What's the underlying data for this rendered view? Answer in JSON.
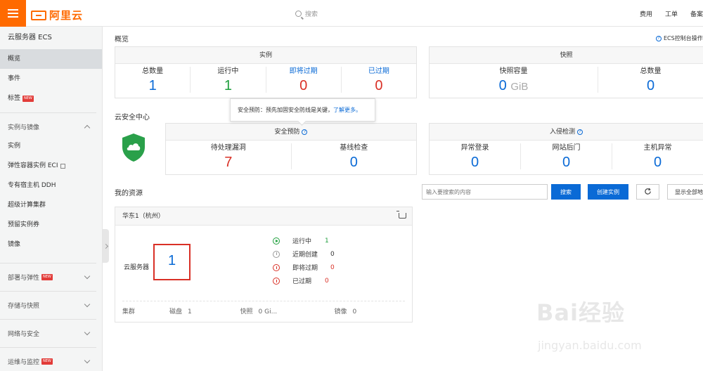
{
  "topbar": {
    "logo_text": "阿里云",
    "search_placeholder": "搜索",
    "links": [
      "费用",
      "工单",
      "备案"
    ]
  },
  "sidebar": {
    "title": "云服务器 ECS",
    "top_items": [
      {
        "label": "概览",
        "active": true,
        "badge": ""
      },
      {
        "label": "事件",
        "active": false,
        "badge": ""
      },
      {
        "label": "标签",
        "active": false,
        "badge": "NEW"
      }
    ],
    "group_instances": {
      "label": "实例与镜像",
      "expanded": true
    },
    "instance_items": [
      "实例",
      "弹性容器实例 ECI",
      "专有宿主机 DDH",
      "超级计算集群",
      "预留实例券",
      "镜像"
    ],
    "groups": [
      {
        "label": "部署与弹性",
        "badge": "NEW"
      },
      {
        "label": "存储与快照",
        "badge": ""
      },
      {
        "label": "网络与安全",
        "badge": ""
      },
      {
        "label": "运维与监控",
        "badge": "NEW"
      }
    ]
  },
  "overview": {
    "title": "概览",
    "console_link": "ECS控制台操作",
    "instances": {
      "header": "实例",
      "metrics": [
        {
          "label": "总数量",
          "value": "1",
          "color": "#0a6ad6"
        },
        {
          "label": "运行中",
          "value": "1",
          "color": "#1e9e3c"
        },
        {
          "label": "即将过期",
          "value": "0",
          "color": "#d93026"
        },
        {
          "label": "已过期",
          "value": "0",
          "color": "#d93026"
        }
      ]
    },
    "snapshots": {
      "header": "快照",
      "capacity_label": "快照容量",
      "capacity_value": "0",
      "capacity_unit": "GiB",
      "total_label": "总数量",
      "total_value": "0"
    }
  },
  "security": {
    "title": "云安全中心",
    "tooltip_text": "安全预防：预先加固安全防线是关键，",
    "tooltip_link": "了解更多。",
    "prevention": {
      "header": "安全预防",
      "metrics": [
        {
          "label": "待处理漏洞",
          "value": "7",
          "color": "#d93026"
        },
        {
          "label": "基线检查",
          "value": "0",
          "color": "#0a6ad6"
        }
      ]
    },
    "intrusion": {
      "header": "入侵检测",
      "metrics": [
        {
          "label": "异常登录",
          "value": "0"
        },
        {
          "label": "网站后门",
          "value": "0"
        },
        {
          "label": "主机异常",
          "value": "0"
        }
      ]
    }
  },
  "resources": {
    "title": "我的资源",
    "search_placeholder": "输入要搜索的内容",
    "search_button": "搜索",
    "create_button": "创建实例",
    "show_all_button": "显示全部地",
    "region": {
      "name": "华东1（杭州）",
      "server_label": "云服务器",
      "server_count": "1",
      "statuses": [
        {
          "label": "运行中",
          "value": "1",
          "color": "#1e9e3c",
          "icon": "play-icon"
        },
        {
          "label": "近期创建",
          "value": "0",
          "color": "#333333",
          "icon": "clock-icon"
        },
        {
          "label": "即将过期",
          "value": "0",
          "color": "#d93026",
          "icon": "alarm-icon"
        },
        {
          "label": "已过期",
          "value": "0",
          "color": "#d93026",
          "icon": "alarm-icon"
        }
      ],
      "footer": [
        {
          "label": "集群",
          "value": ""
        },
        {
          "label": "磁盘",
          "value": "1"
        },
        {
          "label": "快照",
          "value": "0 Gi..."
        },
        {
          "label": "镜像",
          "value": "0"
        }
      ]
    }
  },
  "watermark": {
    "text": "Bai经验",
    "sub": "jingyan.baidu.com"
  }
}
